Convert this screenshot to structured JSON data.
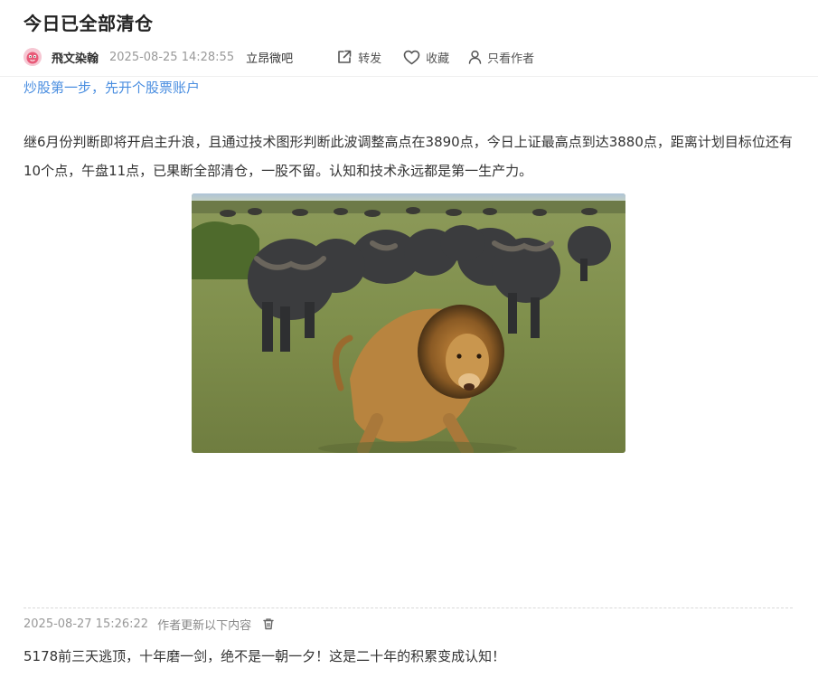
{
  "post": {
    "title": "今日已全部清仓",
    "author": "飛文染翰",
    "published_at": "2025-08-25 14:28:55",
    "source": "立昂微吧"
  },
  "actions": {
    "share_label": "转发",
    "favorite_label": "收藏",
    "author_only_label": "只看作者"
  },
  "icons": {
    "avatar": "pink-cartoon-avatar",
    "share": "share-out-icon",
    "favorite": "heart-icon",
    "author_only": "person-icon",
    "delete": "trash-icon"
  },
  "promo": {
    "link_text": "炒股第一步，先开个股票账户"
  },
  "content": {
    "paragraph": "继6月份判断即将开启主升浪，且通过技术图形判断此波调整高点在3890点，今日上证最高点到达3880点，距离计划目标位还有10个点，午盘11点，已果断全部清仓，一股不留。认知和技术永远都是第一生产力。",
    "image_subject": "lion-running-ahead-of-buffalo-herd"
  },
  "update": {
    "time": "2025-08-27 15:26:22",
    "note": "作者更新以下内容",
    "text": "5178前三天逃顶，十年磨一剑，绝不是一朝一夕！这是二十年的积累变成认知！"
  },
  "colors": {
    "link": "#4a8ee0",
    "title": "#222222",
    "meta_muted": "#999999",
    "avatar_bg": "#f3c9d2"
  }
}
